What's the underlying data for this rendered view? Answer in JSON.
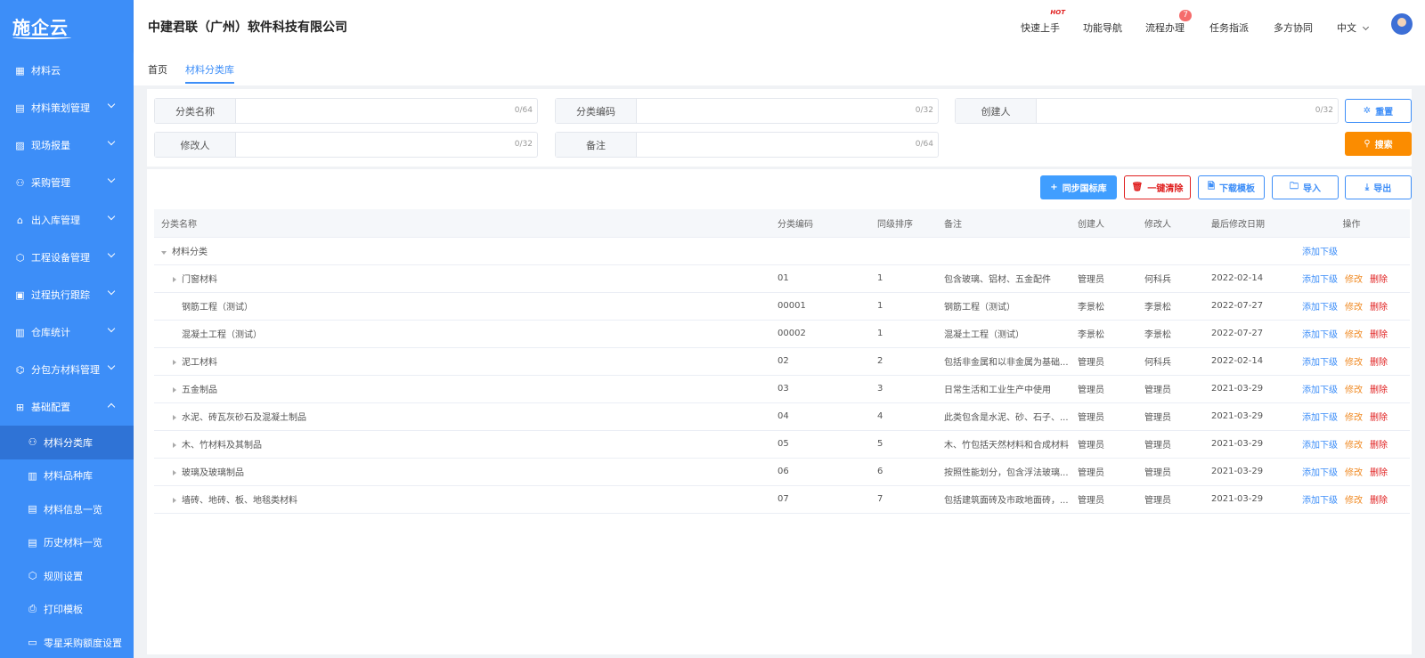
{
  "logo": "施企云",
  "sidebar": {
    "items": [
      {
        "label": "材料云",
        "icon": "grid-icon",
        "chev": ""
      },
      {
        "label": "材料策划管理",
        "icon": "plan-icon",
        "chev": "down"
      },
      {
        "label": "现场报量",
        "icon": "report-icon",
        "chev": "down"
      },
      {
        "label": "采购管理",
        "icon": "purchase-icon",
        "chev": "down"
      },
      {
        "label": "出入库管理",
        "icon": "warehouse-icon",
        "chev": "down"
      },
      {
        "label": "工程设备管理",
        "icon": "cube-icon",
        "chev": "down"
      },
      {
        "label": "过程执行跟踪",
        "icon": "track-icon",
        "chev": "down"
      },
      {
        "label": "仓库统计",
        "icon": "stats-icon",
        "chev": "down"
      },
      {
        "label": "分包方材料管理",
        "icon": "subcontract-icon",
        "chev": "down"
      },
      {
        "label": "基础配置",
        "icon": "config-icon",
        "chev": "up"
      }
    ],
    "sub": [
      "材料分类库",
      "材料品种库",
      "材料信息一览",
      "历史材料一览",
      "规则设置",
      "打印模板",
      "零星采购额度设置"
    ]
  },
  "header": {
    "company": "中建君联（广州）软件科技有限公司",
    "quick": "快速上手",
    "hot": "HOT",
    "nav": "功能导航",
    "flow": "流程办理",
    "flow_badge": "7",
    "task": "任务指派",
    "collab": "多方协同",
    "lang": "中文"
  },
  "tabs": [
    "首页",
    "材料分类库"
  ],
  "filters": {
    "name": {
      "label": "分类名称",
      "count": "0/64"
    },
    "code": {
      "label": "分类编码",
      "count": "0/32"
    },
    "creator": {
      "label": "创建人",
      "count": "0/32"
    },
    "modifier": {
      "label": "修改人",
      "count": "0/32"
    },
    "remark": {
      "label": "备注",
      "count": "0/64"
    },
    "reset": "重置",
    "search": "搜索"
  },
  "toolbar": {
    "sync": "同步国标库",
    "clear": "一键清除",
    "template": "下载模板",
    "import": "导入",
    "export": "导出"
  },
  "table": {
    "headers": [
      "分类名称",
      "分类编码",
      "同级排序",
      "备注",
      "创建人",
      "修改人",
      "最后修改日期",
      "操作"
    ],
    "actions": {
      "add": "添加下级",
      "edit": "修改",
      "delete": "删除"
    },
    "root": "材料分类",
    "rows": [
      {
        "name": "门窗材料",
        "code": "01",
        "order": "1",
        "remark": "包含玻璃、铝材、五金配件",
        "creator": "管理员",
        "modifier": "何科兵",
        "date": "2022-02-14",
        "caret": true
      },
      {
        "name": "钢筋工程（测试）",
        "code": "00001",
        "order": "1",
        "remark": "钢筋工程（测试）",
        "creator": "李景松",
        "modifier": "李景松",
        "date": "2022-07-27",
        "caret": false
      },
      {
        "name": "混凝土工程（测试）",
        "code": "00002",
        "order": "1",
        "remark": "混凝土工程（测试）",
        "creator": "李景松",
        "modifier": "李景松",
        "date": "2022-07-27",
        "caret": false
      },
      {
        "name": "泥工材料",
        "code": "02",
        "order": "2",
        "remark": "包括非金属和以非金属为基础...",
        "creator": "管理员",
        "modifier": "何科兵",
        "date": "2022-02-14",
        "caret": true
      },
      {
        "name": "五金制品",
        "code": "03",
        "order": "3",
        "remark": "日常生活和工业生产中使用",
        "creator": "管理员",
        "modifier": "管理员",
        "date": "2021-03-29",
        "caret": true
      },
      {
        "name": "水泥、砖瓦灰砂石及混凝土制品",
        "code": "04",
        "order": "4",
        "remark": "此类包含是水泥、砂、石子、...",
        "creator": "管理员",
        "modifier": "管理员",
        "date": "2021-03-29",
        "caret": true
      },
      {
        "name": "木、竹材料及其制品",
        "code": "05",
        "order": "5",
        "remark": "木、竹包括天然材料和合成材料",
        "creator": "管理员",
        "modifier": "管理员",
        "date": "2021-03-29",
        "caret": true
      },
      {
        "name": "玻璃及玻璃制品",
        "code": "06",
        "order": "6",
        "remark": "按照性能划分，包含浮法玻璃...",
        "creator": "管理员",
        "modifier": "管理员",
        "date": "2021-03-29",
        "caret": true
      },
      {
        "name": "墙砖、地砖、板、地毯类材料",
        "code": "07",
        "order": "7",
        "remark": "包括建筑面砖及市政地面砖，...",
        "creator": "管理员",
        "modifier": "管理员",
        "date": "2021-03-29",
        "caret": true
      }
    ]
  }
}
